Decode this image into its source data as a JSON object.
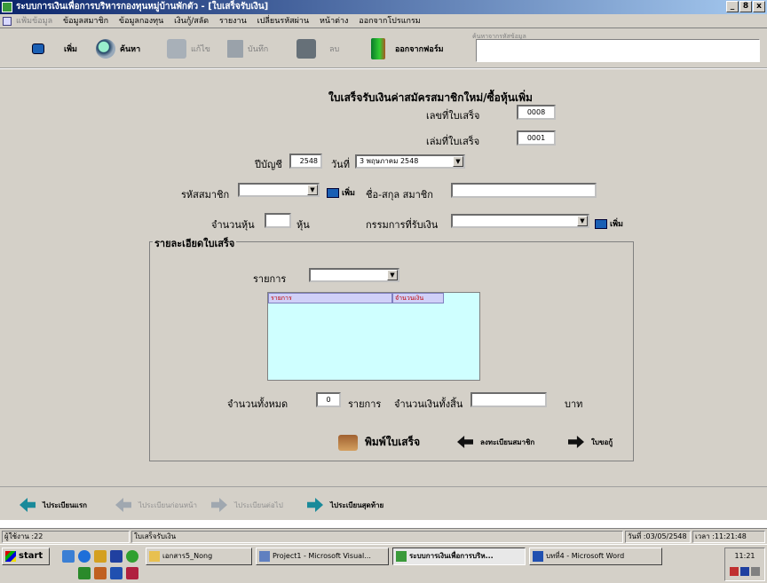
{
  "window": {
    "title": "ระบบการเงินเพื่อการบริหารกองทุนหมู่บ้านพักตัว - [ใบเสร็จรับเงิน]",
    "controls": [
      "_",
      "8",
      "x"
    ]
  },
  "menu": {
    "items": [
      {
        "label": "แฟ้มข้อมูล",
        "enabled": false
      },
      {
        "label": "ข้อมูลสมาชิก",
        "enabled": true
      },
      {
        "label": "ข้อมูลกองทุน",
        "enabled": true
      },
      {
        "label": "เงินกู้/สลัด",
        "enabled": true
      },
      {
        "label": "รายงาน",
        "enabled": true
      },
      {
        "label": "เปลี่ยนรหัสผ่าน",
        "enabled": true
      },
      {
        "label": "หน้าต่าง",
        "enabled": true
      },
      {
        "label": "ออกจากโปรแกรม",
        "enabled": true
      }
    ]
  },
  "toolbar": {
    "add": "เพิ่ม",
    "search": "ค้นหา",
    "edit": "แก้ไข",
    "save": "บันทึก",
    "delete": "ลบ",
    "exit": "ออกจากฟอร์ม",
    "search_box_label": "ค้นหาจากรหัสข้อมูล",
    "search_box_value": ""
  },
  "form": {
    "heading": "ใบเสร็จรับเงินค่าสมัครสมาชิกใหม่/ซื้อหุ้นเพิ่ม",
    "receipt_no_label": "เลขที่ใบเสร็จ",
    "receipt_no": "0008",
    "book_no_label": "เล่มที่ใบเสร็จ",
    "book_no": "0001",
    "fiscal_year_label": "ปีบัญชี",
    "fiscal_year": "2548",
    "date_label": "วันที่",
    "date": "3  พฤษภาคม  2548",
    "member_id_label": "รหัสสมาชิก",
    "member_id": "",
    "add_label": "เพิ่ม",
    "member_name_label": "ชื่อ-สกุล สมาชิก",
    "member_name": "",
    "shares_label": "จำนวนหุ้น",
    "shares": "",
    "shares_unit": "หุ้น",
    "committee_label": "กรรมการที่รับเงิน",
    "committee": "",
    "detail_group": "รายละเอียดใบเสร็จ",
    "item_label": "รายการ",
    "item": "",
    "grid_headers": [
      "รายการ",
      "จำนวนเงิน"
    ],
    "total_count_label": "จำนวนทั้งหมด",
    "total_count": "0",
    "items_unit": "รายการ",
    "total_amount_label": "จำนวนเงินทั้งสิ้น",
    "total_amount": "",
    "baht": "บาท"
  },
  "actions": {
    "print": "พิมพ์ใบเสร็จ",
    "register": "ลงทะเบียนสมาชิก",
    "loan": "ใบขอกู้"
  },
  "nav": {
    "first": "ไประเบียนแรก",
    "prev": "ไประเบียนก่อนหน้า",
    "next": "ไประเบียนต่อไป",
    "last": "ไประเบียนสุดท้าย"
  },
  "status": {
    "user": "ผู้ใช้งาน :22",
    "form": "ใบเสร็จรับเงิน",
    "date": "วันที่ :03/05/2548",
    "time": "เวลา :11:21:48"
  },
  "taskbar": {
    "start": "start",
    "tasks": [
      {
        "label": "เอกสาร5_Nong",
        "active": false
      },
      {
        "label": "Project1 - Microsoft Visual...",
        "active": false
      },
      {
        "label": "ระบบการเงินเพื่อการบริห...",
        "active": true
      },
      {
        "label": "บทที่4 - Microsoft Word",
        "active": false
      }
    ],
    "clock": "11:21"
  },
  "colors": {
    "title_start": "#0a246a",
    "title_end": "#a6caf0",
    "face": "#d4d0c8",
    "grid_bg": "#cfffff",
    "exit_icon": "#1a9a3a"
  }
}
